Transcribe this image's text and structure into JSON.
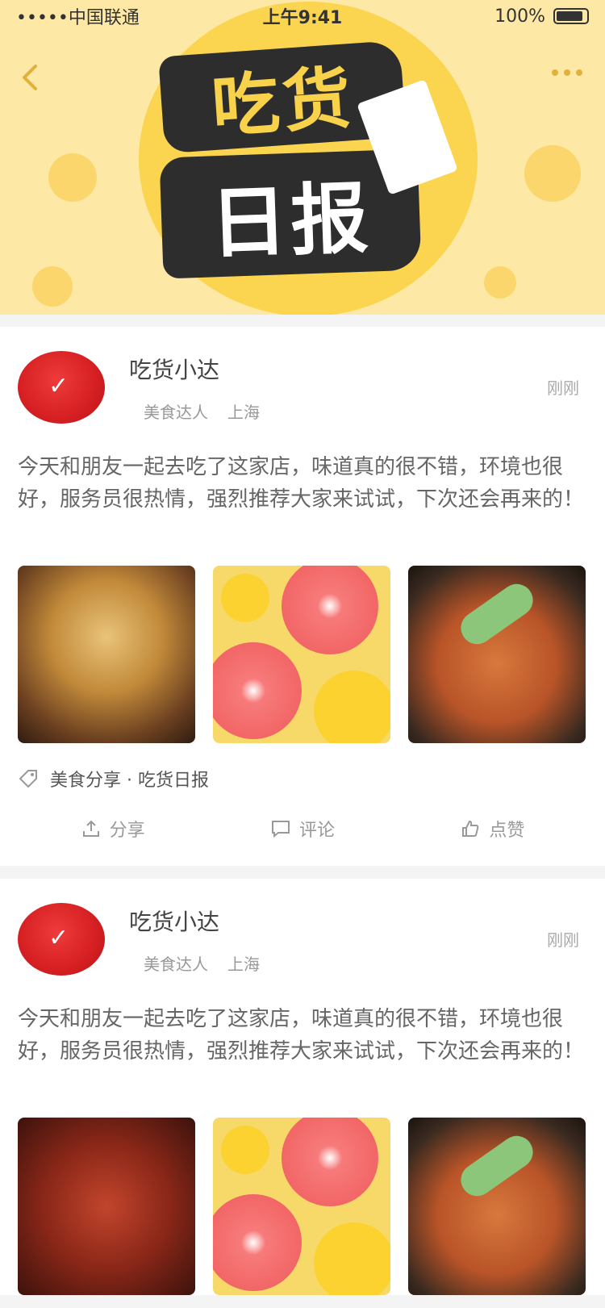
{
  "status_bar": {
    "carrier": "•••••中国联通",
    "time": "上午9:41",
    "battery": "100%"
  },
  "banner": {
    "title_line1": "吃货",
    "title_line2": "日报"
  },
  "posts": [
    {
      "user_name": "吃货小达",
      "user_level": "美食达人",
      "user_location": "上海",
      "time": "刚刚",
      "text": "今天和朋友一起去吃了这家店，味道真的很不错，环境也很好，服务员很热情，强烈推荐大家来试试，下次还会再来的！",
      "photos": [
        "food-pastry",
        "fruit-grapefruit",
        "stirfry-chicken"
      ],
      "tag": "美食分享 · 吃货日报",
      "actions": {
        "share": "分享",
        "comment": "评论",
        "like": "点赞"
      }
    },
    {
      "user_name": "吃货小达",
      "user_level": "美食达人",
      "user_location": "上海",
      "time": "刚刚",
      "text": "今天和朋友一起去吃了这家店，味道真的很不错，环境也很好，服务员很热情，强烈推荐大家来试试，下次还会再来的！",
      "photos": [
        "food-crayfish",
        "fruit-grapefruit",
        "stirfry-chicken"
      ]
    }
  ],
  "colors": {
    "banner_bg": "#fde8a6",
    "banner_circle": "#fbd54f",
    "title_box": "#2d2d2d",
    "avatar_red": "#d51f22"
  },
  "icons": [
    "back-icon",
    "more-icon",
    "tag-icon",
    "share-icon",
    "comment-icon",
    "like-icon"
  ]
}
